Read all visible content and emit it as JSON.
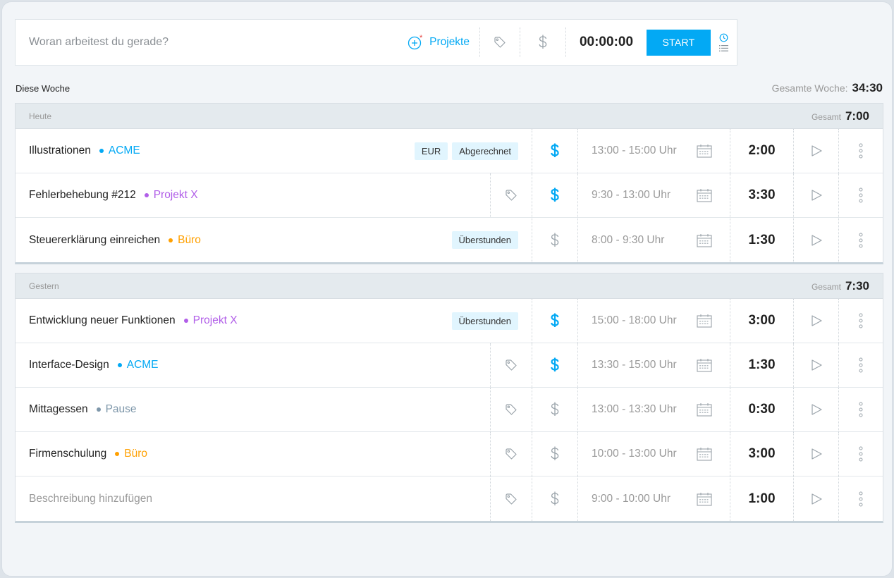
{
  "colors": {
    "accent": "#03a9f4",
    "project_acme": "#03a9f4",
    "project_x": "#b15ee8",
    "project_buero": "#ffa000",
    "project_pause": "#7e97aa",
    "billable_active": "#03a9f4",
    "billable_inactive": "#9aa3aa"
  },
  "timer": {
    "placeholder": "Woran arbeitest du gerade?",
    "project_label": "Projekte",
    "project_icon": "plus-circle-icon",
    "tag_icon": "tag-icon",
    "billable_icon": "dollar-icon",
    "clock": "00:00:00",
    "start_label": "START",
    "mode_icons": [
      "clock-icon",
      "list-icon"
    ]
  },
  "week": {
    "label": "Diese Woche",
    "total_label": "Gesamte Woche:",
    "total": "34:30"
  },
  "days": [
    {
      "title": "Heute",
      "total_label": "Gesamt",
      "total": "7:00",
      "entries": [
        {
          "description": "Illustrationen",
          "project": "ACME",
          "project_color": "#03a9f4",
          "badges": [
            "EUR",
            "Abgerechnet"
          ],
          "billable": true,
          "time": "13:00 - 15:00 Uhr",
          "duration": "2:00"
        },
        {
          "description": "Fehlerbehebung #212",
          "project": "Projekt X",
          "project_color": "#b15ee8",
          "badges": [],
          "billable": true,
          "time": "9:30 - 13:00 Uhr",
          "duration": "3:30"
        },
        {
          "description": "Steuererklärung einreichen",
          "project": "Büro",
          "project_color": "#ffa000",
          "badges": [
            "Überstunden"
          ],
          "billable": false,
          "time": "8:00 - 9:30 Uhr",
          "duration": "1:30"
        }
      ]
    },
    {
      "title": "Gestern",
      "total_label": "Gesamt",
      "total": "7:30",
      "entries": [
        {
          "description": "Entwicklung neuer Funktionen",
          "project": "Projekt X",
          "project_color": "#b15ee8",
          "badges": [
            "Überstunden"
          ],
          "billable": true,
          "time": "15:00 - 18:00 Uhr",
          "duration": "3:00"
        },
        {
          "description": "Interface-Design",
          "project": "ACME",
          "project_color": "#03a9f4",
          "badges": [],
          "billable": true,
          "time": "13:30 - 15:00 Uhr",
          "duration": "1:30"
        },
        {
          "description": "Mittagessen",
          "project": "Pause",
          "project_color": "#7e97aa",
          "badges": [],
          "billable": false,
          "time": "13:00 - 13:30 Uhr",
          "duration": "0:30"
        },
        {
          "description": "Firmenschulung",
          "project": "Büro",
          "project_color": "#ffa000",
          "badges": [],
          "billable": false,
          "time": "10:00 - 13:00 Uhr",
          "duration": "3:00"
        },
        {
          "description": "Beschreibung hinzufügen",
          "project": "",
          "project_color": "",
          "badges": [],
          "billable": false,
          "time": "9:00 - 10:00 Uhr",
          "duration": "1:00",
          "placeholder": true
        }
      ]
    }
  ]
}
